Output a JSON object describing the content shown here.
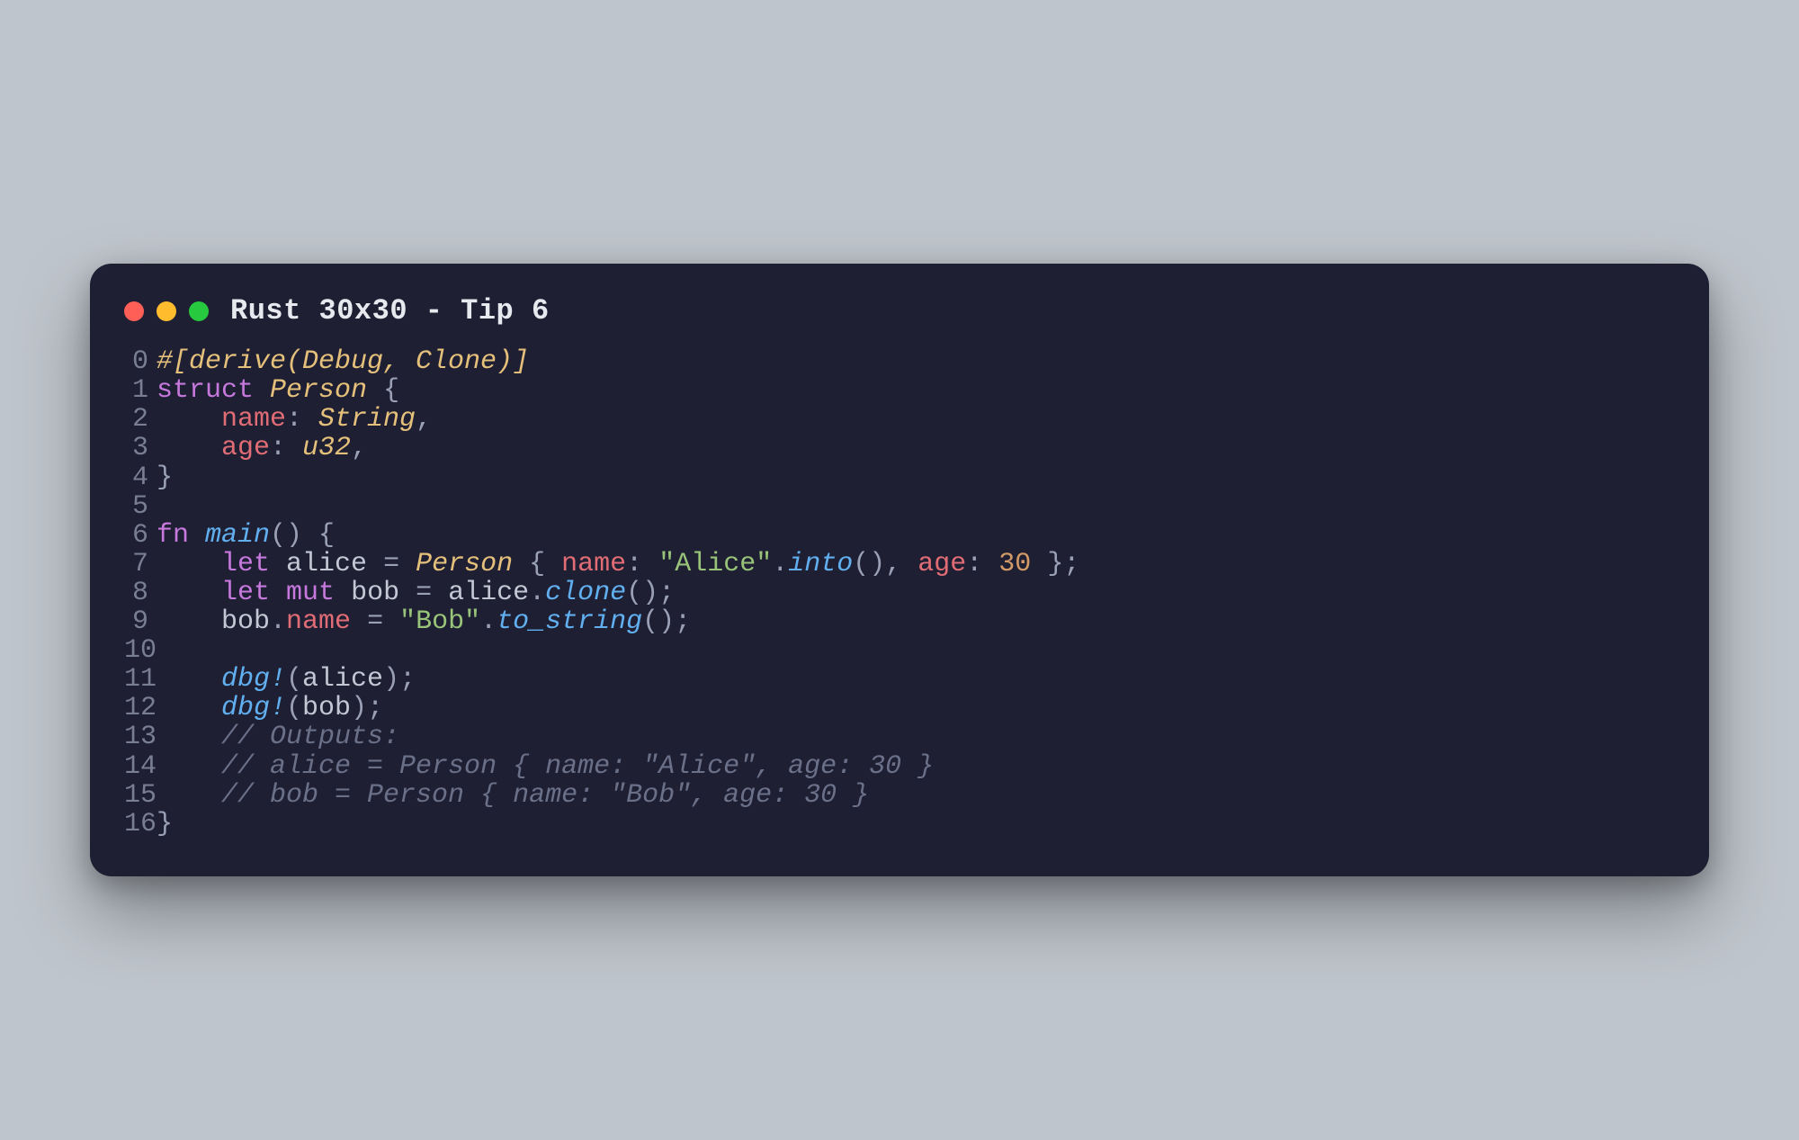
{
  "window": {
    "title": "Rust 30x30 - Tip 6",
    "controls": {
      "close": "red",
      "minimize": "yellow",
      "zoom": "green"
    }
  },
  "code": {
    "lines": [
      {
        "n": "0",
        "t": [
          [
            "attr",
            "#[derive(Debug, Clone)]"
          ]
        ]
      },
      {
        "n": "1",
        "t": [
          [
            "kw",
            "struct"
          ],
          [
            "sp",
            " "
          ],
          [
            "type",
            "Person"
          ],
          [
            "sp",
            " "
          ],
          [
            "punc",
            "{"
          ]
        ]
      },
      {
        "n": "2",
        "t": [
          [
            "sp",
            "    "
          ],
          [
            "field",
            "name"
          ],
          [
            "punc",
            ": "
          ],
          [
            "type",
            "String"
          ],
          [
            "punc",
            ","
          ]
        ]
      },
      {
        "n": "3",
        "t": [
          [
            "sp",
            "    "
          ],
          [
            "field",
            "age"
          ],
          [
            "punc",
            ": "
          ],
          [
            "type",
            "u32"
          ],
          [
            "punc",
            ","
          ]
        ]
      },
      {
        "n": "4",
        "t": [
          [
            "punc",
            "}"
          ]
        ]
      },
      {
        "n": "5",
        "t": []
      },
      {
        "n": "6",
        "t": [
          [
            "kw",
            "fn"
          ],
          [
            "sp",
            " "
          ],
          [
            "func",
            "main"
          ],
          [
            "punc",
            "() {"
          ]
        ]
      },
      {
        "n": "7",
        "t": [
          [
            "sp",
            "    "
          ],
          [
            "kw",
            "let"
          ],
          [
            "sp",
            " "
          ],
          [
            "ident",
            "alice"
          ],
          [
            "sp",
            " "
          ],
          [
            "punc",
            "= "
          ],
          [
            "type",
            "Person"
          ],
          [
            "sp",
            " "
          ],
          [
            "punc",
            "{ "
          ],
          [
            "field",
            "name"
          ],
          [
            "punc",
            ": "
          ],
          [
            "str",
            "\"Alice\""
          ],
          [
            "punc",
            "."
          ],
          [
            "func",
            "into"
          ],
          [
            "punc",
            "(), "
          ],
          [
            "field",
            "age"
          ],
          [
            "punc",
            ": "
          ],
          [
            "num",
            "30"
          ],
          [
            "sp",
            " "
          ],
          [
            "punc",
            "};"
          ]
        ]
      },
      {
        "n": "8",
        "t": [
          [
            "sp",
            "    "
          ],
          [
            "kw",
            "let"
          ],
          [
            "sp",
            " "
          ],
          [
            "kw",
            "mut"
          ],
          [
            "sp",
            " "
          ],
          [
            "ident",
            "bob"
          ],
          [
            "sp",
            " "
          ],
          [
            "punc",
            "= "
          ],
          [
            "ident",
            "alice"
          ],
          [
            "punc",
            "."
          ],
          [
            "func",
            "clone"
          ],
          [
            "punc",
            "();"
          ]
        ]
      },
      {
        "n": "9",
        "t": [
          [
            "sp",
            "    "
          ],
          [
            "ident",
            "bob"
          ],
          [
            "punc",
            "."
          ],
          [
            "field",
            "name"
          ],
          [
            "sp",
            " "
          ],
          [
            "punc",
            "= "
          ],
          [
            "str",
            "\"Bob\""
          ],
          [
            "punc",
            "."
          ],
          [
            "func",
            "to_string"
          ],
          [
            "punc",
            "();"
          ]
        ]
      },
      {
        "n": "10",
        "t": []
      },
      {
        "n": "11",
        "t": [
          [
            "sp",
            "    "
          ],
          [
            "macro",
            "dbg!"
          ],
          [
            "punc",
            "("
          ],
          [
            "ident",
            "alice"
          ],
          [
            "punc",
            ");"
          ]
        ]
      },
      {
        "n": "12",
        "t": [
          [
            "sp",
            "    "
          ],
          [
            "macro",
            "dbg!"
          ],
          [
            "punc",
            "("
          ],
          [
            "ident",
            "bob"
          ],
          [
            "punc",
            ");"
          ]
        ]
      },
      {
        "n": "13",
        "t": [
          [
            "sp",
            "    "
          ],
          [
            "comment",
            "// Outputs:"
          ]
        ]
      },
      {
        "n": "14",
        "t": [
          [
            "sp",
            "    "
          ],
          [
            "comment",
            "// alice = Person { name: \"Alice\", age: 30 }"
          ]
        ]
      },
      {
        "n": "15",
        "t": [
          [
            "sp",
            "    "
          ],
          [
            "comment",
            "// bob = Person { name: \"Bob\", age: 30 }"
          ]
        ]
      },
      {
        "n": "16",
        "t": [
          [
            "punc",
            "}"
          ]
        ]
      }
    ]
  }
}
